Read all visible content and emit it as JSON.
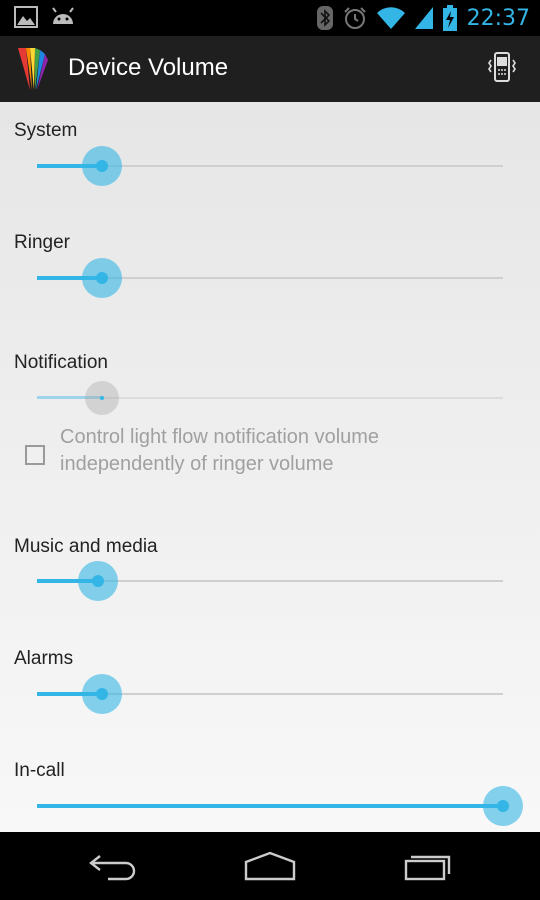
{
  "status_bar": {
    "time": "22:37",
    "icons": [
      "gallery-icon",
      "android-icon",
      "bluetooth-icon",
      "alarm-icon",
      "wifi-icon",
      "signal-icon",
      "battery-charging-icon"
    ]
  },
  "action_bar": {
    "title": "Device Volume",
    "app_icon": "rainbow-logo-icon",
    "action_icon": "vibrate-phone-icon"
  },
  "volumes": [
    {
      "label": "System",
      "level": 0.14,
      "enabled": true
    },
    {
      "label": "Ringer",
      "level": 0.14,
      "enabled": true
    },
    {
      "label": "Notification",
      "level": 0.14,
      "enabled": false
    },
    {
      "label": "Music and media",
      "level": 0.13,
      "enabled": true
    },
    {
      "label": "Alarms",
      "level": 0.14,
      "enabled": true
    },
    {
      "label": "In-call",
      "level": 1.0,
      "enabled": true
    }
  ],
  "notification_option": {
    "label": "Control light flow notification volume independently of ringer volume",
    "checked": false
  },
  "nav_bar": {
    "icons": [
      "back-icon",
      "home-icon",
      "recent-apps-icon"
    ]
  },
  "colors": {
    "accent": "#33b5e5",
    "action_bar_bg": "#1f1f1f"
  }
}
